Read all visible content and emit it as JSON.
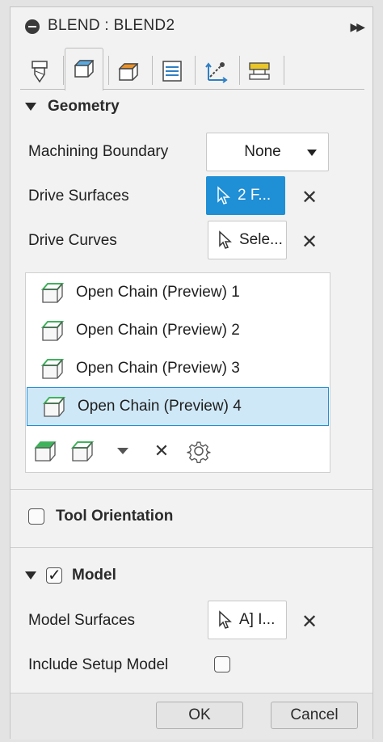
{
  "title": "BLEND : BLEND2",
  "tabs": [
    {
      "icon": "tool-icon",
      "active": false
    },
    {
      "icon": "geometry-icon",
      "active": true
    },
    {
      "icon": "heights-icon",
      "active": false
    },
    {
      "icon": "passes-icon",
      "active": false
    },
    {
      "icon": "linking-icon",
      "active": false
    },
    {
      "icon": "post-process-icon",
      "active": false
    }
  ],
  "geometry": {
    "header": "Geometry",
    "machining_boundary_label": "Machining Boundary",
    "machining_boundary_value": "None",
    "drive_surfaces_label": "Drive Surfaces",
    "drive_surfaces_value": "2 F...",
    "drive_curves_label": "Drive Curves",
    "drive_curves_value": "Sele...",
    "chains": [
      {
        "label": "Open Chain (Preview) 1",
        "selected": false
      },
      {
        "label": "Open Chain (Preview) 2",
        "selected": false
      },
      {
        "label": "Open Chain (Preview) 3",
        "selected": false
      },
      {
        "label": "Open Chain (Preview) 4",
        "selected": true
      }
    ]
  },
  "tool_orientation": {
    "header": "Tool Orientation",
    "checked": false
  },
  "model": {
    "header": "Model",
    "checked": true,
    "model_surfaces_label": "Model Surfaces",
    "model_surfaces_value": "A] I...",
    "include_setup_label": "Include Setup Model",
    "include_setup_checked": false
  },
  "footer": {
    "ok_label": "OK",
    "cancel_label": "Cancel"
  },
  "colors": {
    "accent": "#1f8fd6",
    "selection": "#cfe8f7",
    "chain_green": "#3fb35c"
  }
}
